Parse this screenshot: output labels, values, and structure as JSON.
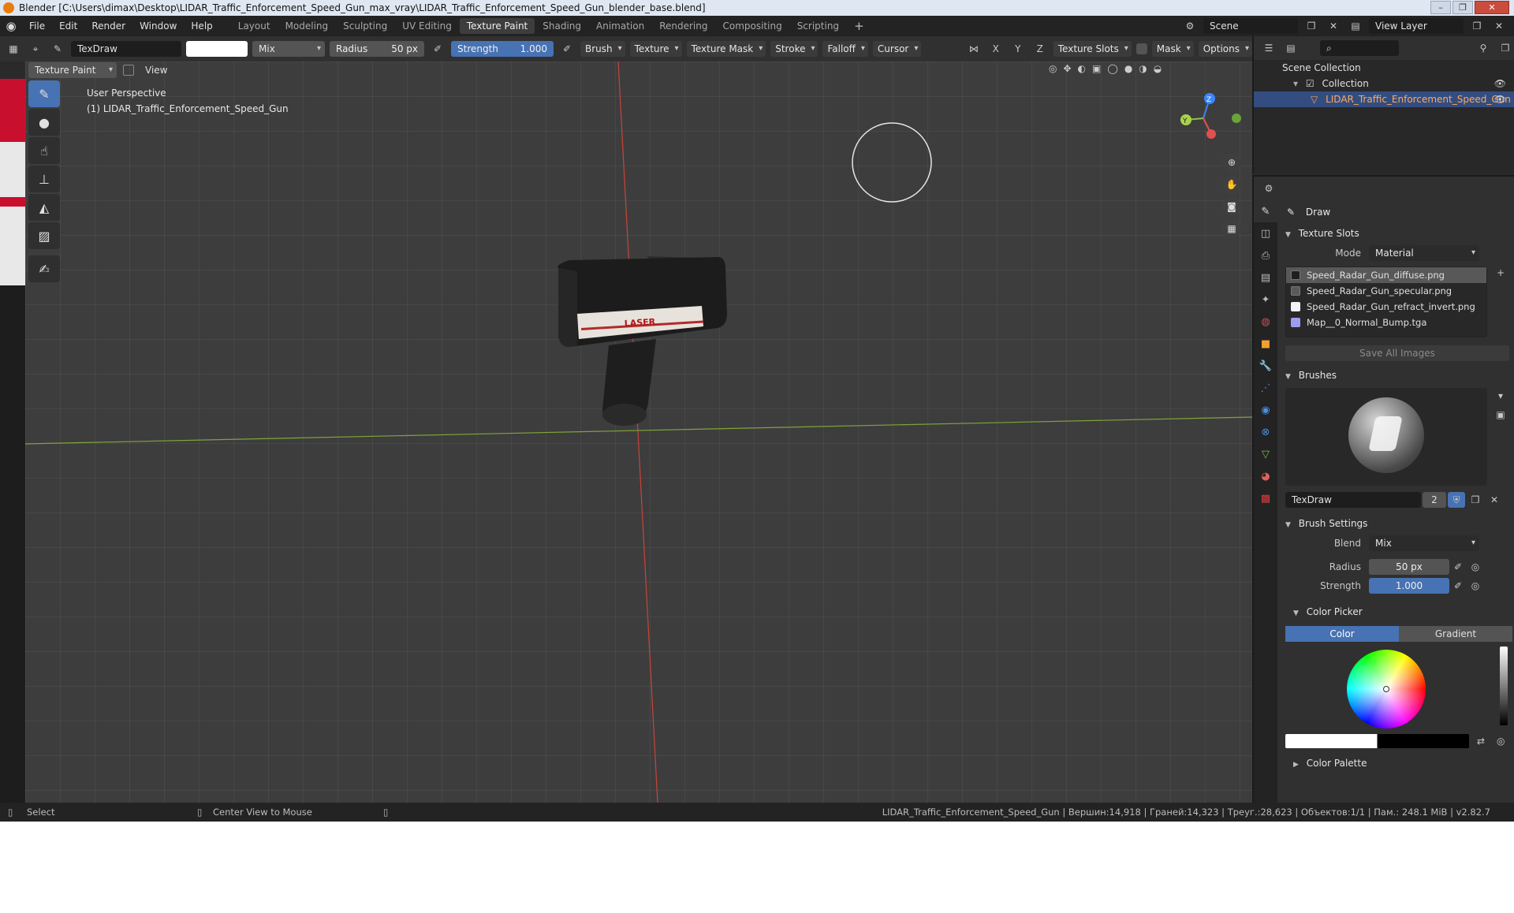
{
  "window": {
    "title": "Blender [C:\\Users\\dimax\\Desktop\\LIDAR_Traffic_Enforcement_Speed_Gun_max_vray\\LIDAR_Traffic_Enforcement_Speed_Gun_blender_base.blend]"
  },
  "menu": {
    "items": [
      "File",
      "Edit",
      "Render",
      "Window",
      "Help"
    ]
  },
  "workspaces": {
    "tabs": [
      "Layout",
      "Modeling",
      "Sculpting",
      "UV Editing",
      "Texture Paint",
      "Shading",
      "Animation",
      "Rendering",
      "Compositing",
      "Scripting"
    ],
    "active": "Texture Paint",
    "add": "+"
  },
  "topright": {
    "scene": "Scene",
    "view_layer": "View Layer"
  },
  "toolheader": {
    "brush_name": "TexDraw",
    "blend": "Mix",
    "radius_label": "Radius",
    "radius_value": "50 px",
    "strength_label": "Strength",
    "strength_value": "1.000",
    "menus": [
      "Brush",
      "Texture",
      "Texture Mask",
      "Stroke",
      "Falloff",
      "Cursor"
    ],
    "axes": [
      "X",
      "Y",
      "Z"
    ],
    "texture_slots": "Texture Slots",
    "mask": "Mask",
    "options": "Options"
  },
  "viewheader": {
    "mode": "Texture Paint",
    "view": "View"
  },
  "viewport": {
    "perspective": "User Perspective",
    "object": "(1) LIDAR_Traffic_Enforcement_Speed_Gun",
    "laser_label": "LASER",
    "gizmo_y": "Y",
    "gizmo_z": "Z"
  },
  "outliner": {
    "root": "Scene Collection",
    "collection": "Collection",
    "object": "LIDAR_Traffic_Enforcement_Speed_Gun"
  },
  "properties": {
    "tool": "Draw",
    "texture_slots_header": "Texture Slots",
    "mode_label": "Mode",
    "mode_value": "Material",
    "slots": [
      {
        "name": "Speed_Radar_Gun_diffuse.png",
        "color": "#1f1f1f"
      },
      {
        "name": "Speed_Radar_Gun_specular.png",
        "color": "#5a5a5a"
      },
      {
        "name": "Speed_Radar_Gun_refract_invert.png",
        "color": "#f4f4f4"
      },
      {
        "name": "Map__0_Normal_Bump.tga",
        "color": "#9d9df0"
      }
    ],
    "save_all": "Save All Images",
    "brushes_header": "Brushes",
    "brush_name": "TexDraw",
    "brush_users": "2",
    "brush_settings_header": "Brush Settings",
    "blend_label": "Blend",
    "blend_value": "Mix",
    "radius_label": "Radius",
    "radius_value": "50 px",
    "strength_label": "Strength",
    "strength_value": "1.000",
    "color_picker_header": "Color Picker",
    "color_tab": "Color",
    "gradient_tab": "Gradient",
    "color_palette_header": "Color Palette"
  },
  "statusbar": {
    "select": "Select",
    "center_view": "Center View to Mouse",
    "stats": "LIDAR_Traffic_Enforcement_Speed_Gun | Вершин:14,918 | Граней:14,323 | Треуг.:28,623 | Объектов:1/1 | Пам.: 248.1 MiB | v2.82.7"
  },
  "colors": {
    "accent": "#4772b3",
    "selection_text": "#ffa95e",
    "x_axis": "#d0443c",
    "y_axis": "#8bc34a",
    "z_axis": "#3a86ff"
  }
}
